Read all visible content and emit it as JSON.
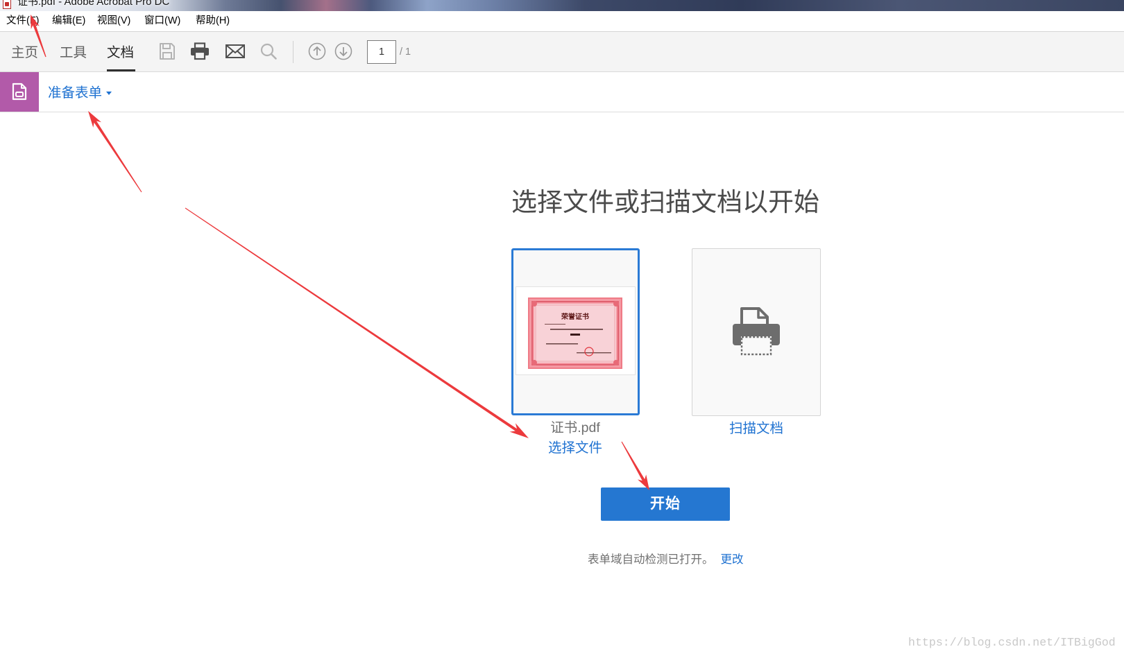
{
  "window": {
    "title": "证书.pdf - Adobe Acrobat Pro DC",
    "app_icon": "pdf-app-icon"
  },
  "menu": {
    "items": [
      "文件(F)",
      "编辑(E)",
      "视图(V)",
      "窗口(W)",
      "帮助(H)"
    ]
  },
  "toolbar": {
    "tabs": [
      {
        "label": "主页",
        "active": false
      },
      {
        "label": "工具",
        "active": false
      },
      {
        "label": "文档",
        "active": true
      }
    ],
    "icons": [
      "save-icon",
      "print-icon",
      "email-icon",
      "search-icon",
      "arrow-up-circle-icon",
      "arrow-down-circle-icon"
    ],
    "page": {
      "current": "1",
      "total": "/ 1"
    }
  },
  "tool_header": {
    "icon": "prepare-form-icon",
    "title": "准备表单"
  },
  "main": {
    "heading": "选择文件或扫描文档以开始",
    "file_card": {
      "thumbnail_title": "荣誉证书",
      "file_name": "证书.pdf",
      "action_label": "选择文件",
      "selected": true
    },
    "scan_card": {
      "icon": "scanner-icon",
      "action_label": "扫描文档"
    },
    "start_button": {
      "label": "开始"
    },
    "footer": {
      "status": "表单域自动检测已打开。",
      "change_link": "更改"
    }
  },
  "watermark": "https://blog.csdn.net/ITBigGod",
  "colors": {
    "accent_blue": "#2577d1",
    "link_blue": "#1f72d1",
    "tool_purple": "#b25aa9",
    "selected_border": "#2a7ad5",
    "annotation_red": "#ec3a3d"
  }
}
